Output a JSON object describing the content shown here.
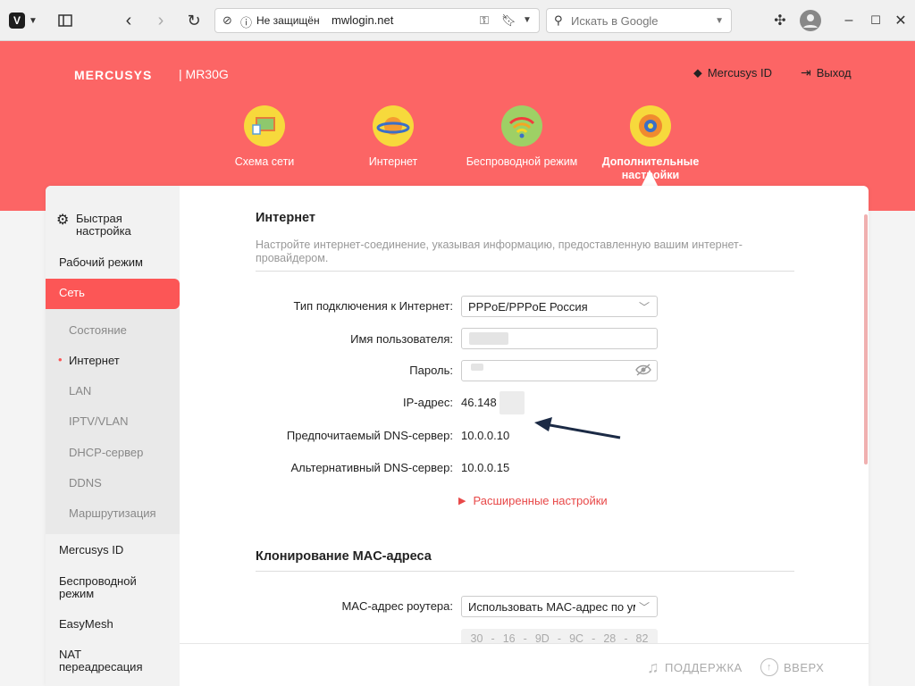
{
  "browser": {
    "not_secure": "Не защищён",
    "url": "mwlogin.net",
    "search_placeholder": "Искать в Google"
  },
  "header": {
    "brand": "MERCUSYS",
    "model": "MR30G",
    "account_link": "Mercusys ID",
    "logout_link": "Выход",
    "nav": [
      {
        "label": "Схема сети",
        "circle_color": "#f7d93c"
      },
      {
        "label": "Интернет",
        "circle_color": "#f7d93c"
      },
      {
        "label": "Беспроводной режим",
        "circle_color": "#9ed065"
      },
      {
        "label": "Дополнительные настройки",
        "circle_color": "#f7d93c"
      }
    ]
  },
  "sidebar": {
    "items": [
      "Быстрая настройка",
      "Рабочий режим",
      "Сеть",
      "Состояние",
      "Интернет",
      "LAN",
      "IPTV/VLAN",
      "DHCP-сервер",
      "DDNS",
      "Маршрутизация",
      "Mercusys ID",
      "Беспроводной режим",
      "EasyMesh",
      "NAT переадресация"
    ]
  },
  "internet": {
    "title": "Интернет",
    "description": "Настройте интернет-соединение, указывая информацию, предоставленную вашим интернет-провайдером.",
    "conn_type_label": "Тип подключения к Интернет:",
    "conn_type_value": "PPPoE/PPPoE Россия",
    "username_label": "Имя пользователя:",
    "password_label": "Пароль:",
    "ip_label": "IP-адрес:",
    "ip_value": "46.148",
    "dns1_label": "Предпочитаемый DNS-сервер:",
    "dns1_value": "10.0.0.10",
    "dns2_label": "Альтернативный DNS-сервер:",
    "dns2_value": "10.0.0.15",
    "advanced": "Расширенные настройки"
  },
  "mac": {
    "title": "Клонирование MAC-адреса",
    "router_mac_label": "MAC-адрес роутера:",
    "router_mac_value": "Использовать MAC-адрес по ум",
    "octets": [
      "30",
      "-",
      "16",
      "-",
      "9D",
      "-",
      "9C",
      "-",
      "28",
      "-",
      "82"
    ]
  },
  "footer": {
    "support": "ПОДДЕРЖКА",
    "top": "ВВЕРХ"
  },
  "colors": {
    "brand": "#fc6565",
    "active": "#fc5656",
    "arrow": "#1b2a45"
  }
}
